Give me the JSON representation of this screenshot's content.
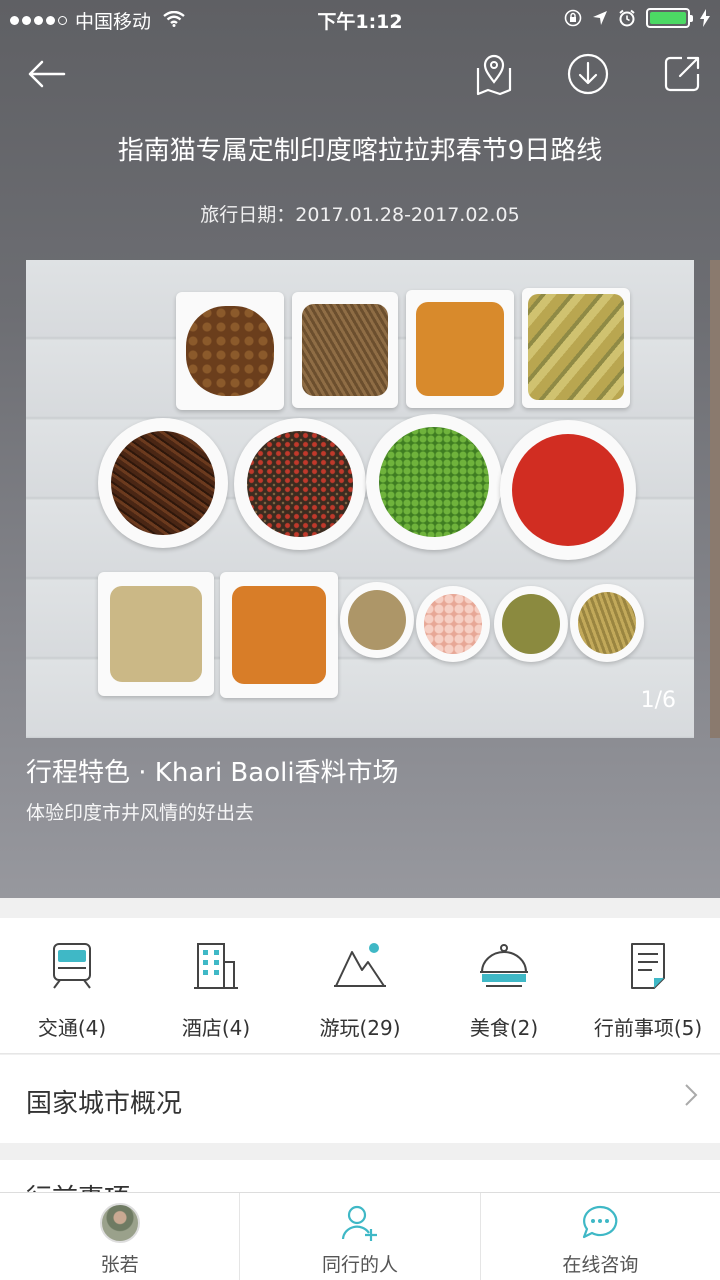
{
  "status": {
    "carrier": "中国移动",
    "time": "下午1:12"
  },
  "header": {
    "title": "指南猫专属定制印度喀拉拉邦春节9日路线",
    "date_label": "旅行日期：2017.01.28-2017.02.05"
  },
  "carousel": {
    "counter": "1/6",
    "caption_title": "行程特色 · Khari Baoli香料市场",
    "caption_subtitle": "体验印度市井风情的好出去"
  },
  "categories": [
    {
      "label": "交通(4)",
      "icon": "train-icon"
    },
    {
      "label": "酒店(4)",
      "icon": "hotel-icon"
    },
    {
      "label": "游玩(29)",
      "icon": "mountain-icon"
    },
    {
      "label": "美食(2)",
      "icon": "food-cloche-icon"
    },
    {
      "label": "行前事项(5)",
      "icon": "document-icon"
    }
  ],
  "overview": {
    "label": "国家城市概况"
  },
  "next_section": {
    "label": "行前事项"
  },
  "bottom_tabs": [
    {
      "label": "张若",
      "icon": "avatar"
    },
    {
      "label": "同行的人",
      "icon": "add-person-icon"
    },
    {
      "label": "在线咨询",
      "icon": "chat-icon"
    }
  ],
  "colors": {
    "accent": "#3fb8c6",
    "battery": "#4cd964"
  }
}
